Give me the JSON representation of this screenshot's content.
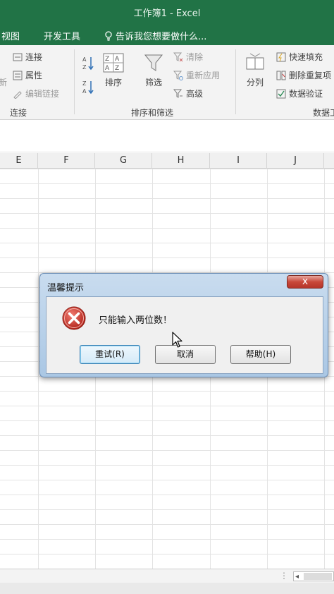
{
  "window": {
    "title": "工作簿1 - Excel"
  },
  "tabs": [
    {
      "label": "视图"
    },
    {
      "label": "开发工具"
    },
    {
      "label": "告诉我您想要做什么..."
    }
  ],
  "ribbon": {
    "connections": {
      "items": [
        "连接",
        "属性",
        "编辑链接"
      ],
      "partial_label": "新",
      "group_label": "连接"
    },
    "sort_filter": {
      "sort_az": "A↓Z",
      "sort_za": "Z↓A",
      "sort": "排序",
      "filter": "筛选",
      "clear": "清除",
      "reapply": "重新应用",
      "advanced": "高级",
      "group_label": "排序和筛选"
    },
    "data_tools": {
      "text_to_columns": "分列",
      "flash_fill": "快速填充",
      "remove_duplicates": "删除重复项",
      "validation": "数据验证",
      "group_label": "数据工"
    }
  },
  "columns": [
    "E",
    "F",
    "G",
    "H",
    "I",
    "J"
  ],
  "dialog": {
    "title": "温馨提示",
    "close": "x",
    "message": "只能输入两位数！",
    "buttons": {
      "retry": "重试(R)",
      "cancel": "取消",
      "help": "帮助(H)"
    }
  },
  "status": {
    "dots": "⋮",
    "scroll_left": "◂"
  },
  "colors": {
    "excel_green": "#217346",
    "error_red": "#c9302c"
  }
}
